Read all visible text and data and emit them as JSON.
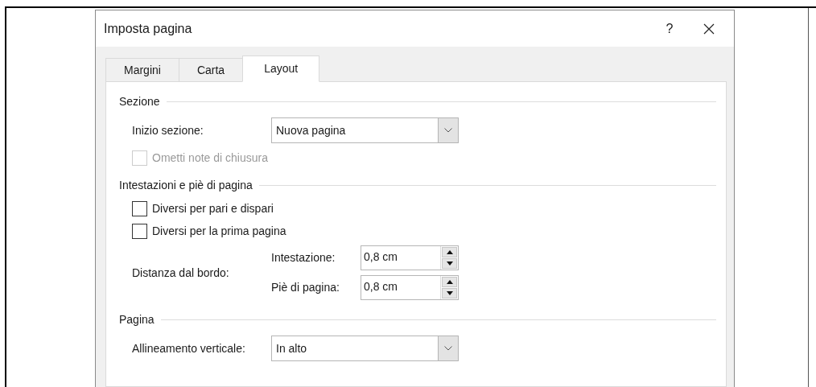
{
  "dialog": {
    "title": "Imposta pagina",
    "help_button": "?"
  },
  "tabs": [
    {
      "label": "Margini",
      "selected": false
    },
    {
      "label": "Carta",
      "selected": false
    },
    {
      "label": "Layout",
      "selected": true
    }
  ],
  "sections": [
    {
      "title": "Sezione",
      "items": [
        {
          "kind": "dropdown",
          "label": "Inizio sezione:",
          "value": "Nuova pagina"
        },
        {
          "kind": "checkbox",
          "label": "Ometti note di chiusura",
          "checked": false,
          "disabled": true
        }
      ]
    },
    {
      "title": "Intestazioni e piè di pagina",
      "items": [
        {
          "kind": "checkbox",
          "label": "Diversi per pari e dispari",
          "checked": false,
          "disabled": false
        },
        {
          "kind": "checkbox",
          "label": "Diversi per la prima pagina",
          "checked": false,
          "disabled": false
        },
        {
          "kind": "spin_group",
          "label": "Distanza dal bordo:",
          "fields": [
            {
              "label": "Intestazione:",
              "value": "0,8 cm"
            },
            {
              "label": "Piè di pagina:",
              "value": "0,8 cm"
            }
          ]
        }
      ]
    },
    {
      "title": "Pagina",
      "items": [
        {
          "kind": "dropdown",
          "label": "Allineamento verticale:",
          "value": "In alto"
        }
      ]
    }
  ]
}
